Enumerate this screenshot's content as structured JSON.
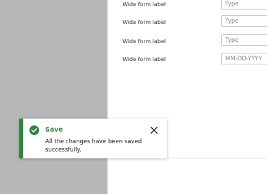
{
  "form": {
    "rows": [
      {
        "label": "Wide form label",
        "placeholder": "Type"
      },
      {
        "label": "Wide form label",
        "placeholder": "Type"
      },
      {
        "label": "Wide form label",
        "placeholder": "Type"
      },
      {
        "label": "Wide form label",
        "placeholder": "MM-DD-YYYY"
      }
    ]
  },
  "toast": {
    "title": "Save",
    "message": "All the changes have been saved successfully.",
    "icon": "check-circle-icon",
    "close_icon": "close-icon",
    "accent_color": "#2e8540"
  },
  "colors": {
    "overlay": "#b5b8b6",
    "panel": "#ffffff",
    "success": "#2e8540"
  }
}
